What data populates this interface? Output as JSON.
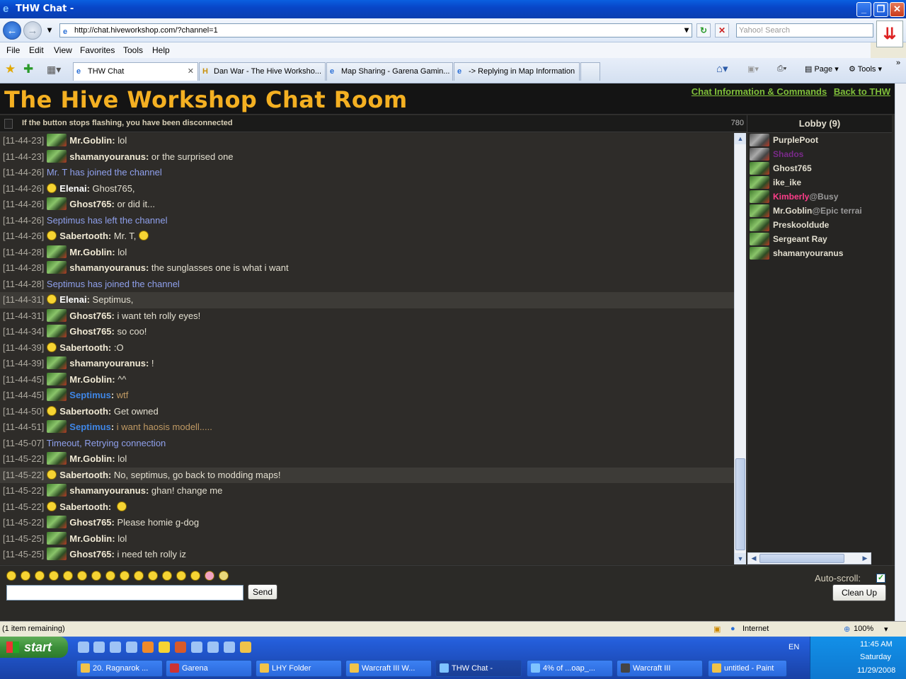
{
  "window": {
    "title": "THW Chat -"
  },
  "address": {
    "url": "http://chat.hiveworkshop.com/?channel=1",
    "search_placeholder": "Yahoo! Search"
  },
  "menu": [
    "File",
    "Edit",
    "View",
    "Favorites",
    "Tools",
    "Help"
  ],
  "tabs": [
    "THW Chat",
    "Dan War - The Hive Worksho...",
    "Map Sharing - Garena Gamin...",
    "-> Replying in Map Information"
  ],
  "toolbar": {
    "page": "Page",
    "tools": "Tools"
  },
  "chat": {
    "title": "The Hive Workshop Chat Room",
    "link_info": "Chat Information & Commands",
    "link_back": "Back to THW",
    "status_msg": "If the button stops flashing, you have been disconnected",
    "counter": "780",
    "lines": [
      {
        "ts": "[11-44-23]",
        "user": "Mr.Goblin",
        "msg": "lol"
      },
      {
        "ts": "[11-44-23]",
        "user": "shamanyouranus",
        "msg": "or the surprised one"
      },
      {
        "ts": "[11-44-26]",
        "sys": "Mr. T has joined the channel"
      },
      {
        "ts": "[11-44-26]",
        "user": "Elenai",
        "msg": "Ghost765,"
      },
      {
        "ts": "[11-44-26]",
        "user": "Ghost765",
        "msg": "or did it..."
      },
      {
        "ts": "[11-44-26]",
        "sys": "Septimus has left the channel"
      },
      {
        "ts": "[11-44-26]",
        "user": "Sabertooth",
        "msg": "Mr. T,"
      },
      {
        "ts": "[11-44-28]",
        "user": "Mr.Goblin",
        "msg": "lol"
      },
      {
        "ts": "[11-44-28]",
        "user": "shamanyouranus",
        "msg": "the sunglasses one is what i want"
      },
      {
        "ts": "[11-44-28]",
        "sys": "Septimus has joined the channel"
      },
      {
        "ts": "[11-44-31]",
        "user": "Elenai",
        "msg": "Septimus,"
      },
      {
        "ts": "[11-44-31]",
        "user": "Ghost765",
        "msg": "i want teh rolly eyes!"
      },
      {
        "ts": "[11-44-34]",
        "user": "Ghost765",
        "msg": "so coo!"
      },
      {
        "ts": "[11-44-39]",
        "user": "Sabertooth",
        "msg": ":O"
      },
      {
        "ts": "[11-44-39]",
        "user": "shamanyouranus",
        "msg": "!"
      },
      {
        "ts": "[11-44-45]",
        "user": "Mr.Goblin",
        "msg": "^^"
      },
      {
        "ts": "[11-44-45]",
        "user": "Septimus",
        "msg": "wtf"
      },
      {
        "ts": "[11-44-50]",
        "user": "Sabertooth",
        "msg": "Get owned"
      },
      {
        "ts": "[11-44-51]",
        "user": "Septimus",
        "msg": "i want haosis modell....."
      },
      {
        "ts": "[11-45-07]",
        "sys": "Timeout, Retrying connection"
      },
      {
        "ts": "[11-45-22]",
        "user": "Mr.Goblin",
        "msg": "lol"
      },
      {
        "ts": "[11-45-22]",
        "user": "Sabertooth",
        "msg": "No, septimus, go back to modding maps!"
      },
      {
        "ts": "[11-45-22]",
        "user": "shamanyouranus",
        "msg": "ghan! change me"
      },
      {
        "ts": "[11-45-22]",
        "user": "Sabertooth",
        "msg": ""
      },
      {
        "ts": "[11-45-22]",
        "user": "Ghost765",
        "msg": "Please homie g-dog"
      },
      {
        "ts": "[11-45-25]",
        "user": "Mr.Goblin",
        "msg": "lol"
      },
      {
        "ts": "[11-45-25]",
        "user": "Ghost765",
        "msg": "i need teh rolly iz"
      }
    ],
    "lobby_title": "Lobby (9)",
    "lobby": [
      {
        "name": "PurplePoot",
        "status": "",
        "color": "#e3dfd0"
      },
      {
        "name": "Shados",
        "status": "",
        "color": "#7a2a8a"
      },
      {
        "name": "Ghost765",
        "status": "",
        "color": "#e3dfd0"
      },
      {
        "name": "ike_ike",
        "status": "",
        "color": "#e3dfd0"
      },
      {
        "name": "Kimberly",
        "status": "@Busy",
        "color": "#ff3d8a"
      },
      {
        "name": "Mr.Goblin",
        "status": "@Epic terrai",
        "color": "#e3dfd0"
      },
      {
        "name": "Preskooldude",
        "status": "",
        "color": "#e3dfd0"
      },
      {
        "name": "Sergeant Ray",
        "status": "",
        "color": "#e3dfd0"
      },
      {
        "name": "shamanyouranus",
        "status": "",
        "color": "#e3dfd0"
      }
    ],
    "send": "Send",
    "autoscroll": "Auto-scroll:",
    "cleanup": "Clean Up"
  },
  "statusbar": {
    "left": "(1 item remaining)",
    "zone": "Internet",
    "zoom": "100%"
  },
  "taskbar": {
    "start": "start",
    "lang": "EN",
    "time": "11:45 AM",
    "day": "Saturday",
    "date": "11/29/2008",
    "buttons": [
      "20. Ragnarok ...",
      "Garena",
      "LHY Folder",
      "Warcraft III W...",
      "THW Chat -",
      "4% of ...oap_...",
      "Warcraft III",
      "untitled - Paint"
    ]
  }
}
